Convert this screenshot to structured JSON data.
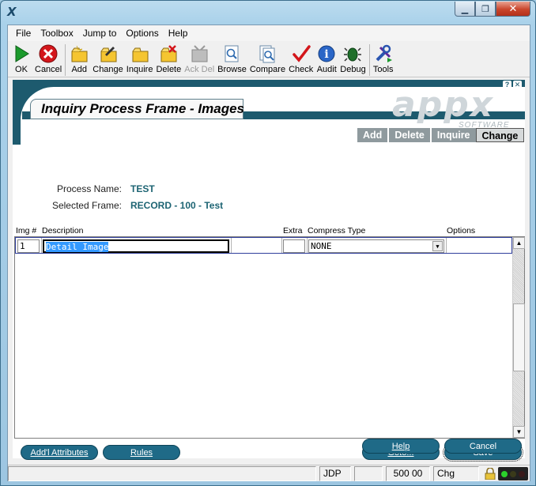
{
  "window": {
    "app_icon": "X",
    "minimize_glyph": "▁",
    "maximize_glyph": "❐",
    "close_glyph": "✕"
  },
  "menu": [
    "File",
    "Toolbox",
    "Jump to",
    "Options",
    "Help"
  ],
  "toolbar": [
    {
      "label": "OK",
      "icon": "ok-icon",
      "enabled": true
    },
    {
      "label": "Cancel",
      "icon": "cancel-icon",
      "enabled": true
    },
    {
      "label": "Add",
      "icon": "add-icon",
      "enabled": true
    },
    {
      "label": "Change",
      "icon": "change-icon",
      "enabled": true
    },
    {
      "label": "Inquire",
      "icon": "inquire-icon",
      "enabled": true
    },
    {
      "label": "Delete",
      "icon": "delete-icon",
      "enabled": true
    },
    {
      "label": "Ack Del",
      "icon": "ack-del-icon",
      "enabled": false
    },
    {
      "label": "Browse",
      "icon": "browse-icon",
      "enabled": true
    },
    {
      "label": "Compare",
      "icon": "compare-icon",
      "enabled": true
    },
    {
      "label": "Check",
      "icon": "check-icon",
      "enabled": true
    },
    {
      "label": "Audit",
      "icon": "audit-icon",
      "enabled": true
    },
    {
      "label": "Debug",
      "icon": "debug-icon",
      "enabled": true
    },
    {
      "label": "Tools",
      "icon": "tools-icon",
      "enabled": true
    }
  ],
  "form": {
    "title": "Inquiry Process Frame - Images",
    "logo": "appx",
    "logo_sub": "SOFTWARE",
    "help_glyph": "?",
    "close_glyph": "✕",
    "modes": [
      "Add",
      "Delete",
      "Inquire",
      "Change"
    ],
    "active_mode": "Change",
    "process_name_label": "Process Name:",
    "process_name": "TEST",
    "selected_frame_label": "Selected Frame:",
    "selected_frame": "RECORD - 100 - Test"
  },
  "grid": {
    "columns": [
      "Img #",
      "Description",
      "Extra",
      "Compress Type",
      "Options"
    ],
    "rows": [
      {
        "img": "1",
        "description": "Detail Image",
        "extra": "",
        "compress_type": "NONE",
        "options": ""
      }
    ],
    "scroll_up": "▲",
    "scroll_down": "▼",
    "dropdown_glyph": "▼"
  },
  "buttons": {
    "addl_attributes": "Add'l Attributes",
    "rules": "Rules",
    "goto": "Goto...",
    "save": "Save",
    "help": "Help",
    "cancel": "Cancel"
  },
  "status": {
    "user": "JDP",
    "value": "500 00",
    "mode": "Chg"
  },
  "colors": {
    "header_teal": "#1d5a6e",
    "value_teal": "#1d6473",
    "button_blue": "#1f6a87",
    "selection": "#3399ff"
  }
}
